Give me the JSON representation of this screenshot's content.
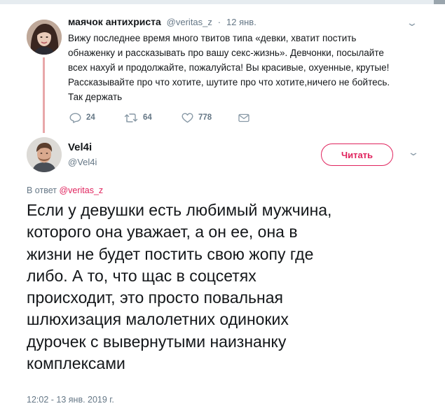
{
  "parent_tweet": {
    "display_name": "маячок антихриста",
    "handle": "@veritas_z",
    "separator": "·",
    "date": "12 янв.",
    "text_lines": [
      "Вижу последнее время много твитов типа «девки, хватит постить",
      "обнаженку и рассказывать про вашу секс-жизнь». Девчонки, посылайте",
      "всех нахуй и продолжайте, пожалуйста! Вы красивые, охуенные, крутые!",
      "Рассказывайте про что хотите, шутите про что хотите,ничего не бойтесь.",
      "Так держать"
    ],
    "replies": "24",
    "retweets": "64",
    "likes": "778",
    "avatar_icon": "user-avatar-photo",
    "reply_icon": "reply-icon",
    "retweet_icon": "retweet-icon",
    "like_icon": "heart-icon",
    "dm_icon": "envelope-icon"
  },
  "main_tweet": {
    "display_name": "Vel4i",
    "handle": "@Vel4i",
    "follow_label": "Читать",
    "reply_prefix": "В ответ",
    "reply_mention": "@veritas_z",
    "text_lines": [
      "Если у девушки есть любимый мужчина,",
      "которого она уважает, а он ее, она в",
      "жизни не будет постить свою жопу где",
      "либо. А то, что щас в соцсетях",
      "происходит, это просто повальная",
      "шлюхизация малолетних одиноких",
      "дурочек с вывернутыми наизнанку",
      "комплексами"
    ],
    "timestamp": "12:02 - 13 янв. 2019 г.",
    "avatar_icon": "user-avatar-photo"
  },
  "colors": {
    "accent": "#e0245e",
    "thread_line": "#e8a7a9",
    "secondary_text": "#657786",
    "primary_text": "#14171a"
  }
}
